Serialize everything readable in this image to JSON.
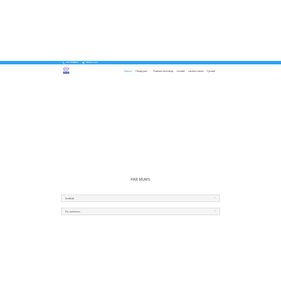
{
  "topbar": {
    "phone": "+371 67888612",
    "email": "Rakstiet mums"
  },
  "nav": {
    "items": [
      {
        "label": "Sākums",
        "active": true,
        "dropdown": false
      },
      {
        "label": "Pakalpojumi",
        "active": false,
        "dropdown": true
      },
      {
        "label": "Praktiskā informācija",
        "active": false,
        "dropdown": false
      },
      {
        "label": "Kontakti",
        "active": false,
        "dropdown": false
      },
      {
        "label": "Latviešu valoda",
        "active": false,
        "dropdown": false
      },
      {
        "label": "Русский",
        "active": false,
        "dropdown": false
      }
    ]
  },
  "about": {
    "title": "PAR MUMS",
    "toggles": [
      {
        "label": "Sertifikāti"
      },
      {
        "label": "Par uzņēmumu"
      }
    ]
  },
  "colors": {
    "accent": "#2ea3f2"
  },
  "icons": {
    "phone": "phone-icon",
    "email": "envelope-icon",
    "toggle": "plus-icon"
  }
}
